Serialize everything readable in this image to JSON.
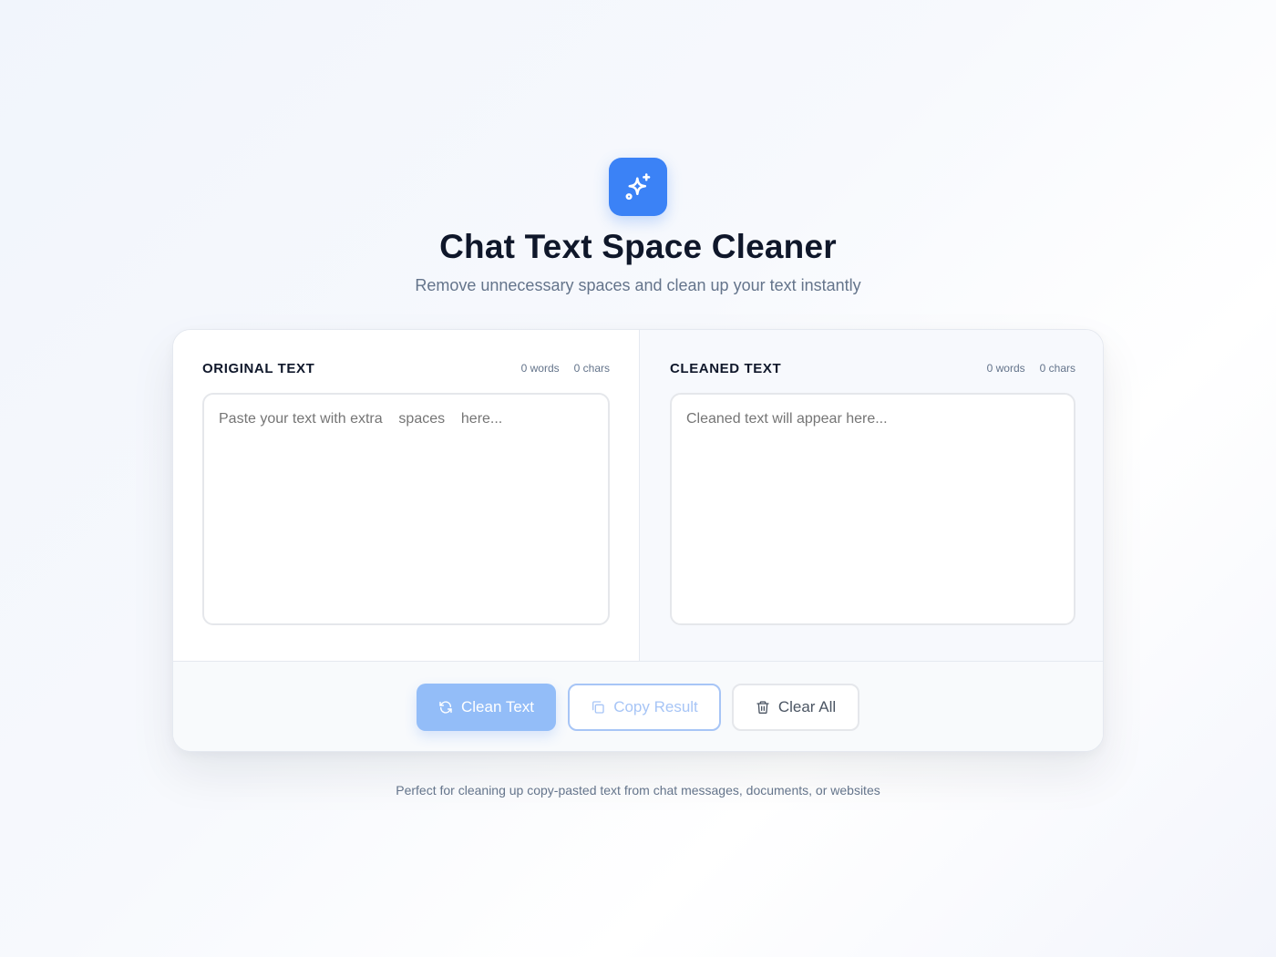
{
  "header": {
    "logo_icon": "sparkles-icon",
    "title": "Chat Text Space Cleaner",
    "subtitle": "Remove unnecessary spaces and clean up your text instantly"
  },
  "original": {
    "label": "ORIGINAL TEXT",
    "words": "0 words",
    "chars": "0 chars",
    "placeholder": "Paste your text with extra    spaces    here...",
    "value": ""
  },
  "cleaned": {
    "label": "CLEANED TEXT",
    "words": "0 words",
    "chars": "0 chars",
    "placeholder": "Cleaned text will appear here...",
    "value": ""
  },
  "actions": {
    "clean_label": "Clean Text",
    "clean_icon": "refresh-icon",
    "copy_label": "Copy Result",
    "copy_icon": "copy-icon",
    "clear_label": "Clear All",
    "clear_icon": "trash-icon"
  },
  "footer": {
    "tagline": "Perfect for cleaning up copy-pasted text from chat messages, documents, or websites"
  },
  "colors": {
    "accent": "#3b82f6",
    "accent_disabled": "#93bdf8",
    "heading": "#0f172a",
    "muted": "#64748b"
  }
}
